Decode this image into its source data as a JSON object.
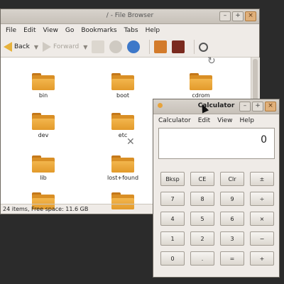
{
  "file_browser": {
    "title": "/ - File Browser",
    "window_buttons": {
      "min": "–",
      "max": "+",
      "close": "×"
    },
    "menu": [
      "File",
      "Edit",
      "View",
      "Go",
      "Bookmarks",
      "Tabs",
      "Help"
    ],
    "toolbar": {
      "back": "Back",
      "forward": "Forward"
    },
    "items": [
      "bin",
      "boot",
      "cdrom",
      "dev",
      "etc",
      "lib",
      "lost+found"
    ],
    "status": "24 items, Free space: 11.6 GB",
    "colors": {
      "folder": "#e39a2b",
      "back_arrow": "#e7b23b",
      "home_icon": "#d37b2b",
      "refresh_icon": "#3d78c9"
    }
  },
  "calculator": {
    "title": "Calculator",
    "window_buttons": {
      "min": "–",
      "max": "+",
      "close": "×"
    },
    "menu": [
      "Calculator",
      "Edit",
      "View",
      "Help"
    ],
    "display": "0",
    "keys": [
      "Bksp",
      "CE",
      "Clr",
      "±",
      "7",
      "8",
      "9",
      "÷",
      "4",
      "5",
      "6",
      "×",
      "1",
      "2",
      "3",
      "−",
      "0",
      ".",
      "=",
      "+"
    ]
  }
}
